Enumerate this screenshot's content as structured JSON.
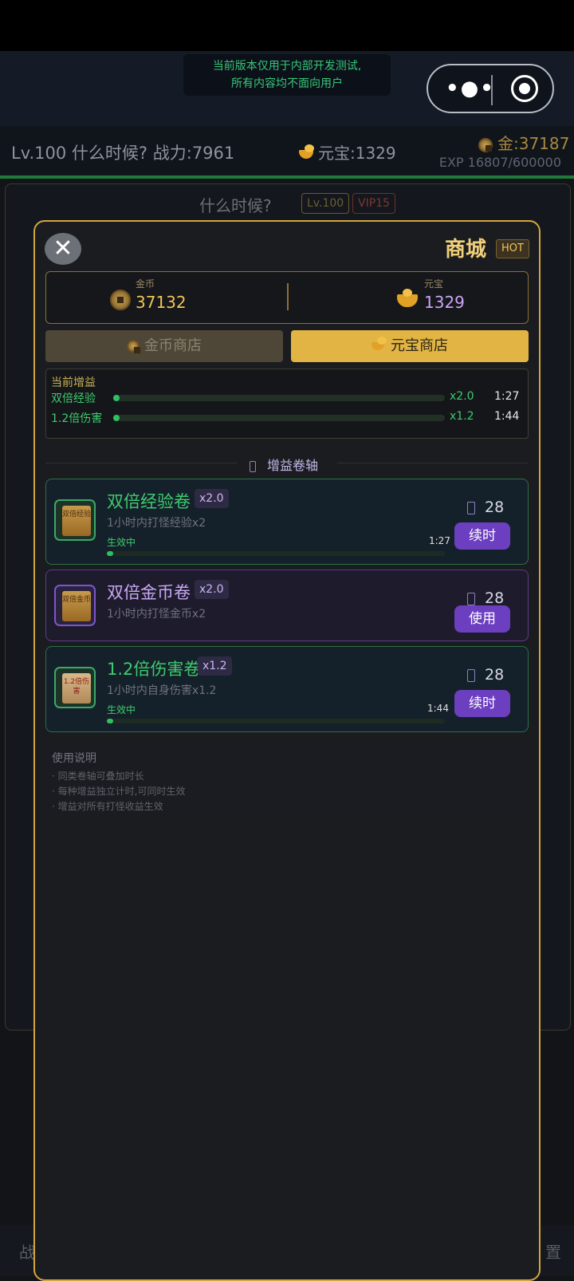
{
  "system": {
    "dev_notice_line1": "当前版本仅用于内部开发测试,",
    "dev_notice_line2": "所有内容均不面向用户"
  },
  "header": {
    "player": "Lv.100 什么时候?  战力:7961",
    "yuanbao": "元宝:1329",
    "gold": "金:37187",
    "exp": "EXP 16807/600000"
  },
  "background": {
    "name": "什么时候?",
    "level_tag": "Lv.100",
    "vip_tag": "VIP15"
  },
  "shop": {
    "title": "商城",
    "hot_badge": "HOT",
    "close_icon": "close-icon",
    "wallet": {
      "gold_label": "金币",
      "gold_value": "37132",
      "yb_label": "元宝",
      "yb_value": "1329"
    },
    "tabs": {
      "gold_shop": "金币商店",
      "yb_shop": "元宝商店",
      "active": "yb_shop"
    },
    "buffs": {
      "title": "当前增益",
      "rows": [
        {
          "name": "双倍经验",
          "mult": "x2.0",
          "time": "1:27",
          "progress": 0.01
        },
        {
          "name": "1.2倍伤害",
          "mult": "x1.2",
          "time": "1:44",
          "progress": 0.01
        }
      ]
    },
    "section_title": "增益卷轴",
    "cards": [
      {
        "name": "双倍经验卷",
        "mult": "x2.0",
        "desc": "1小时内打怪经验x2",
        "active_text": "生效中",
        "time": "1:27",
        "progress": 0.01,
        "price": "28",
        "button": "续时",
        "scroll_text": "双倍经验",
        "name_color": "#3ecb6e"
      },
      {
        "name": "双倍金币卷",
        "mult": "x2.0",
        "desc": "1小时内打怪金币x2",
        "price": "28",
        "button": "使用",
        "scroll_text": "双倍金币",
        "name_color": "#c8a9f5"
      },
      {
        "name": "1.2倍伤害卷",
        "mult": "x1.2",
        "desc": "1小时内自身伤害x1.2",
        "active_text": "生效中",
        "time": "1:44",
        "progress": 0.01,
        "price": "28",
        "button": "续时",
        "scroll_text": "1.2倍伤害",
        "name_color": "#3ecb6e"
      }
    ],
    "usage": {
      "title": "使用说明",
      "items": [
        "· 同类卷轴可叠加时长",
        "· 每种增益独立计时,可同时生效",
        "· 增益对所有打怪收益生效"
      ]
    }
  },
  "bottom_nav": {
    "left": "战",
    "right": "置"
  }
}
